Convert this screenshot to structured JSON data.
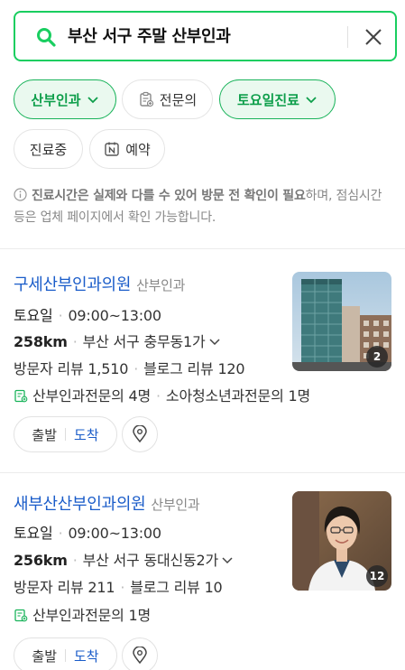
{
  "search": {
    "query": "부산 서구 주말 산부인과"
  },
  "filters": {
    "chip1": "산부인과",
    "chip2": "전문의",
    "chip3": "토요일진료",
    "chip4": "진료중",
    "chip5": "예약"
  },
  "notice": {
    "bold": "진료시간은 실제와 다를 수 있어 방문 전 확인이 필요",
    "rest": "하며, 점심시간 등은 업체 페이지에서 확인 가능합니다."
  },
  "results": [
    {
      "name": "구세산부인과의원",
      "category": "산부인과",
      "day": "토요일",
      "hours": "09:00~13:00",
      "distance": "258km",
      "address": "부산 서구 충무동1가",
      "visitor_reviews": "방문자 리뷰 1,510",
      "blog_reviews": "블로그 리뷰 120",
      "specialists_a": "산부인과전문의 4명",
      "specialists_b": "소아청소년과전문의 1명",
      "photo_count": "2",
      "depart": "출발",
      "arrive": "도착"
    },
    {
      "name": "새부산산부인과의원",
      "category": "산부인과",
      "day": "토요일",
      "hours": "09:00~13:00",
      "distance": "256km",
      "address": "부산 서구 동대신동2가",
      "visitor_reviews": "방문자 리뷰 211",
      "blog_reviews": "블로그 리뷰 10",
      "specialists_a": "산부인과전문의 1명",
      "photo_count": "12",
      "depart": "출발",
      "arrive": "도착"
    }
  ]
}
